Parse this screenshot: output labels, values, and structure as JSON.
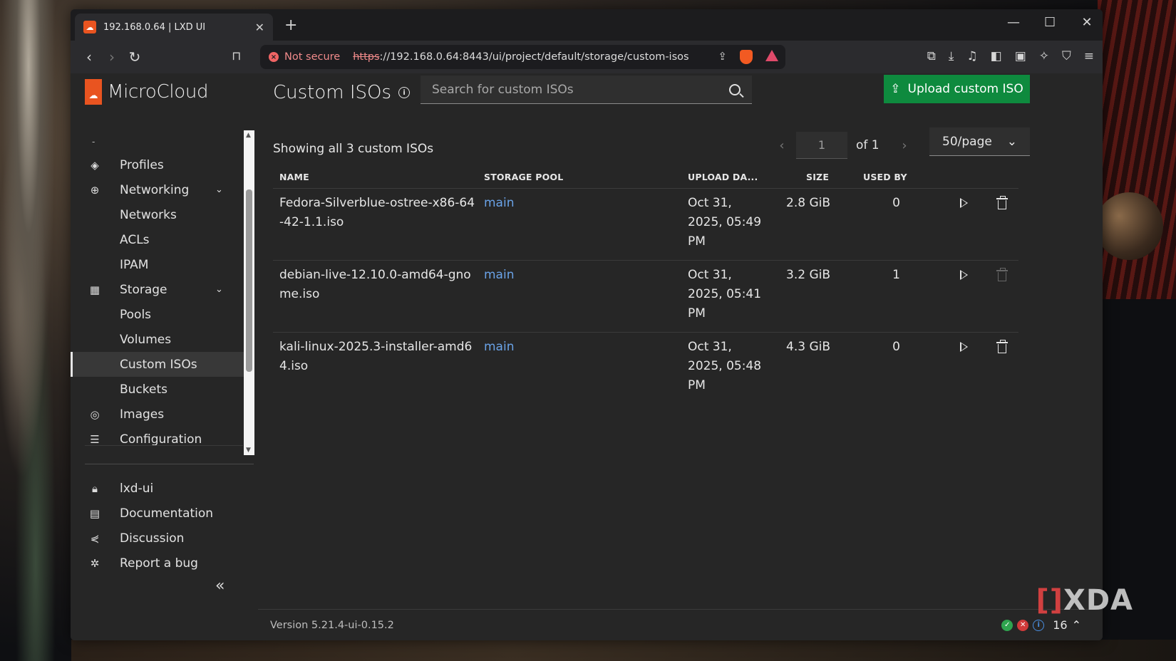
{
  "browser": {
    "tab_title": "192.168.0.64 | LXD UI",
    "tab_close": "✕",
    "new_tab": "+",
    "not_secure": "Not secure",
    "url_scheme": "https",
    "url_rest": "://192.168.0.64:8443/ui/project/default/storage/custom-isos"
  },
  "app": {
    "brand": "MicroCloud",
    "page_title": "Custom ISOs",
    "search_placeholder": "Search for custom ISOs",
    "upload_label": "Upload custom ISO"
  },
  "sidebar": {
    "items": [
      {
        "label": "Profiles",
        "icon": "profiles-icon"
      },
      {
        "label": "Networking",
        "icon": "networking-icon"
      },
      {
        "label": "Networks"
      },
      {
        "label": "ACLs"
      },
      {
        "label": "IPAM"
      },
      {
        "label": "Storage",
        "icon": "storage-icon"
      },
      {
        "label": "Pools"
      },
      {
        "label": "Volumes"
      },
      {
        "label": "Custom ISOs"
      },
      {
        "label": "Buckets"
      },
      {
        "label": "Images",
        "icon": "images-icon"
      },
      {
        "label": "Configuration",
        "icon": "configuration-icon"
      }
    ],
    "bottom_items": [
      {
        "label": "lxd-ui",
        "icon": "lock-icon"
      },
      {
        "label": "Documentation",
        "icon": "documentation-icon"
      },
      {
        "label": "Discussion",
        "icon": "share-icon"
      },
      {
        "label": "Report a bug",
        "icon": "bug-icon"
      }
    ],
    "collapse": "«"
  },
  "list": {
    "summary": "Showing all 3 custom ISOs",
    "page_value": "1",
    "page_of": "of 1",
    "per_page": "50/page",
    "columns": [
      "NAME",
      "STORAGE POOL",
      "UPLOAD DA...",
      "SIZE",
      "USED BY"
    ],
    "rows": [
      {
        "name": "Fedora-Silverblue-ostree-x86-64-42-1.1.iso",
        "pool": "main",
        "date": "Oct 31, 2025, 05:49 PM",
        "size": "2.8 GiB",
        "used_by": "0",
        "delete_enabled": true
      },
      {
        "name": "debian-live-12.10.0-amd64-gnome.iso",
        "pool": "main",
        "date": "Oct 31, 2025, 05:41 PM",
        "size": "3.2 GiB",
        "used_by": "1",
        "delete_enabled": false
      },
      {
        "name": "kali-linux-2025.3-installer-amd64.iso",
        "pool": "main",
        "date": "Oct 31, 2025, 05:48 PM",
        "size": "4.3 GiB",
        "used_by": "0",
        "delete_enabled": true
      }
    ]
  },
  "footer": {
    "version": "Version 5.21.4-ui-0.15.2",
    "notification_count": "16"
  },
  "watermark": "XDA"
}
